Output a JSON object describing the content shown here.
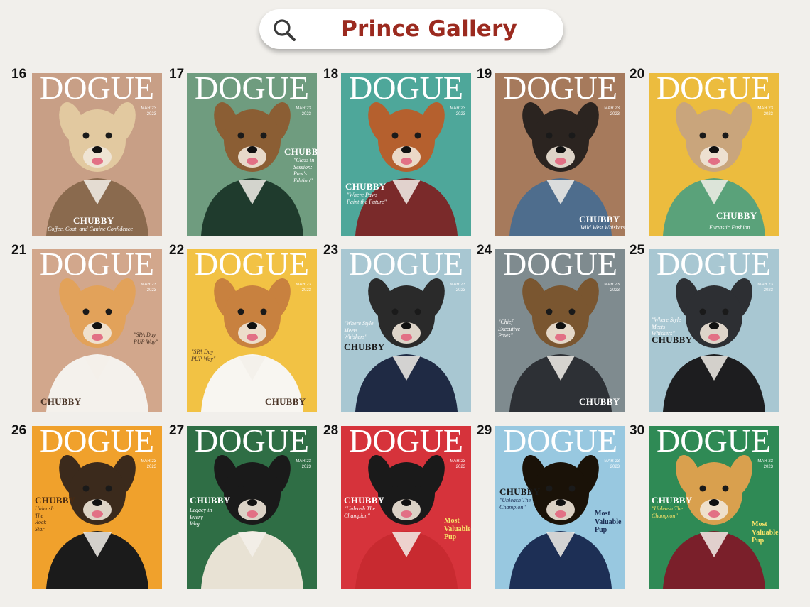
{
  "search": {
    "title": "Prince Gallery"
  },
  "masthead": "DOGUE",
  "issue_line1": "MAR 23",
  "issue_line2": "2023",
  "brand": "CHUBBY",
  "covers": [
    {
      "number": "16",
      "bg": "#c89f86",
      "fur": "#e2c9a0",
      "outfit": "#8a6a4e",
      "tagline": "Coffee, Coat, and Canine Confidence",
      "tagColor": "#ffffff",
      "brandColor": "#ffffff"
    },
    {
      "number": "17",
      "bg": "#6f9c7f",
      "fur": "#8b5e34",
      "outfit": "#1f3b2d",
      "tagline": "\"Class in\nSession:\nPaw's Edition\"",
      "tagColor": "#ffffff",
      "brandColor": "#ffffff"
    },
    {
      "number": "18",
      "bg": "#4ea79a",
      "fur": "#b5602e",
      "outfit": "#7a2a2a",
      "tagline": "\"Where Paws\nPaint the Future\"",
      "tagColor": "#ffffff",
      "brandColor": "#ffffff"
    },
    {
      "number": "19",
      "bg": "#a67a5c",
      "fur": "#2b2420",
      "outfit": "#4e6d8d",
      "tagline": "Wild West Whiskers",
      "tagColor": "#ffffff",
      "brandColor": "#ffffff"
    },
    {
      "number": "20",
      "bg": "#ecbc3e",
      "fur": "#c9a57c",
      "outfit": "#5aa27a",
      "tagline": "Furtastic Fashion",
      "tagColor": "#ffffff",
      "brandColor": "#ffffff"
    },
    {
      "number": "21",
      "bg": "#d2a78c",
      "fur": "#e2a25a",
      "outfit": "#f4f1ec",
      "tagline": "\"SPA Day\nPUP Way\"",
      "tagColor": "#4a3426",
      "brandColor": "#4a3426"
    },
    {
      "number": "22",
      "bg": "#f2c244",
      "fur": "#c8813f",
      "outfit": "#f8f6f1",
      "tagline": "\"SPA Day\nPUP Way\"",
      "tagColor": "#4a3426",
      "brandColor": "#4a3426"
    },
    {
      "number": "23",
      "bg": "#a8c7d2",
      "fur": "#2a2a2a",
      "outfit": "#1f2a44",
      "tagline": "\"Where Style\nMeets\nWhiskers\"",
      "tagColor": "#ffffff",
      "brandColor": "#1a1a1a"
    },
    {
      "number": "24",
      "bg": "#7f8b8f",
      "fur": "#7a5630",
      "outfit": "#2d3035",
      "tagline": "\"Chief\nExecutive\nPaws\"",
      "tagColor": "#ffffff",
      "brandColor": "#ffffff"
    },
    {
      "number": "25",
      "bg": "#a8c7d2",
      "fur": "#2d2f33",
      "outfit": "#1d1d1f",
      "tagline": "\"Where Style\nMeets\nWhiskers\"",
      "tagColor": "#ffffff",
      "brandColor": "#1a1a1a"
    },
    {
      "number": "26",
      "bg": "#f0a12c",
      "fur": "#3b2a1c",
      "outfit": "#1b1b1b",
      "tagline": "Unleash\nThe\nRock\nStar",
      "tagColor": "#4a2b12",
      "brandColor": "#4a2b12"
    },
    {
      "number": "27",
      "bg": "#2f6e45",
      "fur": "#1a1a1a",
      "outfit": "#e8e2d4",
      "tagline": "Legacy in\nEvery\nWag",
      "tagColor": "#ffffff",
      "brandColor": "#ffffff"
    },
    {
      "number": "28",
      "bg": "#d6333b",
      "fur": "#1a1a1a",
      "outfit": "#c82a30",
      "tagline": "\"Unleash The\nChampion\"",
      "tagColor": "#ffffff",
      "brandColor": "#ffffff",
      "extra": "Most\nValuable\nPup",
      "extraColor": "#f7e36a"
    },
    {
      "number": "29",
      "bg": "#98c8e0",
      "fur": "#1a1208",
      "outfit": "#1d2f55",
      "tagline": "\"Unleash The\nChampion\"",
      "tagColor": "#1d2f55",
      "brandColor": "#1a1a1a",
      "extra": "Most\nValuable\nPup",
      "extraColor": "#1d2f55"
    },
    {
      "number": "30",
      "bg": "#2f8a55",
      "fur": "#d9a04e",
      "outfit": "#7a1f2a",
      "tagline": "\"Unleash The\nChampion\"",
      "tagColor": "#f7e36a",
      "brandColor": "#ffffff",
      "extra": "Most\nValuable\nPup",
      "extraColor": "#f7e36a"
    }
  ]
}
